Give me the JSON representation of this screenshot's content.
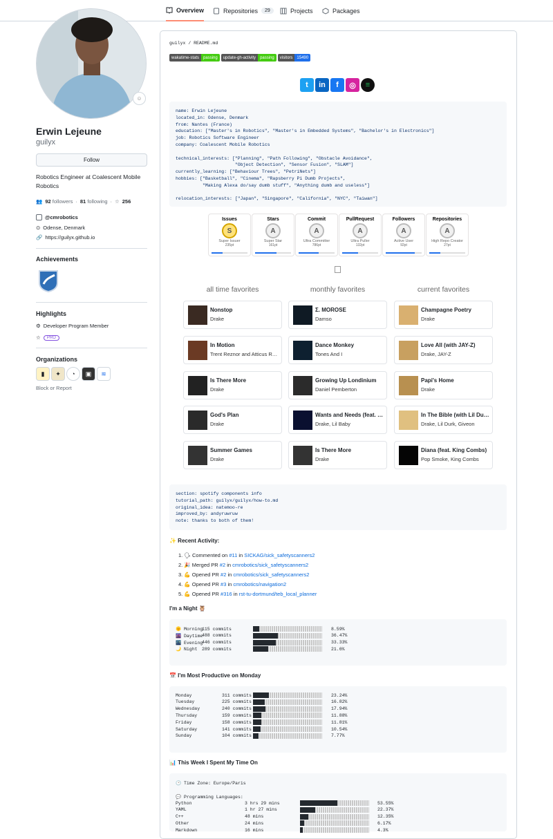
{
  "tabs": [
    {
      "label": "Overview",
      "icon": "book-icon"
    },
    {
      "label": "Repositories",
      "count": "29",
      "icon": "repo-icon"
    },
    {
      "label": "Projects",
      "icon": "project-icon"
    },
    {
      "label": "Packages",
      "icon": "package-icon"
    }
  ],
  "profile": {
    "name": "Erwin Lejeune",
    "login": "guilyx",
    "follow_label": "Follow",
    "bio": "Robotics Engineer at Coalescent Mobile Robotics",
    "followers": "92",
    "followers_label": "followers",
    "following": "81",
    "following_label": "following",
    "stars": "256",
    "org": "@cmrobotics",
    "location": "Odense, Denmark",
    "website": "https://guilyx.github.io"
  },
  "sidebar": {
    "achievements_title": "Achievements",
    "highlights_title": "Highlights",
    "highlight_member": "Developer Program Member",
    "pro_label": "PRO",
    "organizations_title": "Organizations",
    "block_label": "Block or Report"
  },
  "readme": {
    "crumb_user": "guilyx",
    "crumb_sep": "/",
    "crumb_file": "README.md",
    "shields": [
      {
        "label": "wakatime-stats",
        "value": "passing",
        "color": "#4c1"
      },
      {
        "label": "update-gh-activity",
        "value": "passing",
        "color": "#4c1"
      },
      {
        "label": "visitors",
        "value": "15490",
        "color": "#1f6feb"
      }
    ],
    "code1": "name: Erwin Lejeune\nlocated_in: Odense, Denmark\nfrom: Nantes (France)\neducation: [\"Master's in Robotics\", \"Master's in Embedded Systems\", \"Bachelor's in Electronics\"]\njob: Robotics Software Engineer\ncompany: Coalescent Mobile Robotics\n\ntechnical_interests: [\"Planning\", \"Path Following\", \"Obstacle Avoidance\",\n                      \"Object Detection\", \"Sensor Fusion\", \"SLAM\"]\ncurrently_learning: [\"Behaviour Trees\", \"PetriNets\"]\nhobbies: [\"Basketball\", \"Cinema\", \"Rapsberry Pi Dumb Projects\",\n          \"Making Alexa do/say dumb stuff\", \"Anything dumb and useless\"]\n\nrelocation_interests: [\"Japan\", \"Singapore\", \"California\", \"NYC\", \"Taiwan\"]",
    "trophies": [
      {
        "title": "Issues",
        "rank": "S",
        "rank_title": "Super Issuer",
        "points": "235pt",
        "progress": 0.3
      },
      {
        "title": "Stars",
        "rank": "A",
        "rank_title": "Super Star",
        "points": "161pt",
        "progress": 0.6
      },
      {
        "title": "Commit",
        "rank": "A",
        "rank_title": "Ultra Committer",
        "points": "786pt",
        "progress": 0.55
      },
      {
        "title": "PullRequest",
        "rank": "A",
        "rank_title": "Ultra Puller",
        "points": "132pt",
        "progress": 0.45
      },
      {
        "title": "Followers",
        "rank": "A",
        "rank_title": "Active User",
        "points": "92pt",
        "progress": 0.8
      },
      {
        "title": "Repositories",
        "rank": "A",
        "rank_title": "High Repo Creator",
        "points": "27pt",
        "progress": 0.3
      }
    ],
    "fav_headers": [
      "all time favorites",
      "monthly favorites",
      "current favorites"
    ],
    "favorites": [
      [
        {
          "t": "Nonstop",
          "a": "Drake"
        },
        {
          "t": "In Motion",
          "a": "Trent Reznor and Atticus Ross"
        },
        {
          "t": "Is There More",
          "a": "Drake"
        },
        {
          "t": "God's Plan",
          "a": "Drake"
        },
        {
          "t": "Summer Games",
          "a": "Drake"
        }
      ],
      [
        {
          "t": "Σ. MOROSE",
          "a": "Damso"
        },
        {
          "t": "Dance Monkey",
          "a": "Tones And I"
        },
        {
          "t": "Growing Up Londinium",
          "a": "Daniel Pemberton"
        },
        {
          "t": "Wants and Needs (feat. Lil Baby)",
          "a": "Drake, Lil Baby"
        },
        {
          "t": "Is There More",
          "a": "Drake"
        }
      ],
      [
        {
          "t": "Champagne Poetry",
          "a": "Drake"
        },
        {
          "t": "Love All (with JAY-Z)",
          "a": "Drake, JAY-Z"
        },
        {
          "t": "Papi's Home",
          "a": "Drake"
        },
        {
          "t": "In The Bible (with Lil Durk & Giveon)",
          "a": "Drake, Lil Durk, Giveon"
        },
        {
          "t": "Diana (feat. King Combs)",
          "a": "Pop Smoke, King Combs"
        }
      ]
    ],
    "code2": "section: spotify components info\ntutorial_path: guilyx/guilyx/how-to.md\noriginal_idea: natemoo-re\nimproved_by: andyruwruw\nnote: thanks to both of them!",
    "recent_title": "✨ Recent Activity:",
    "activity": [
      {
        "pre": "1. 🗣 Commented on ",
        "link1": "#11",
        "mid": " in ",
        "link2": "SICKAG/sick_safetyscanners2"
      },
      {
        "pre": "2. 🎉 Merged PR ",
        "link1": "#2",
        "mid": " in ",
        "link2": "cmrobotics/sick_safetyscanners2"
      },
      {
        "pre": "3. 💪 Opened PR ",
        "link1": "#2",
        "mid": " in ",
        "link2": "cmrobotics/sick_safetyscanners2"
      },
      {
        "pre": "4. 💪 Opened PR ",
        "link1": "#3",
        "mid": " in ",
        "link2": "cmrobotics/navigation2"
      },
      {
        "pre": "5. 💪 Opened PR ",
        "link1": "#316",
        "mid": " in ",
        "link2": "rst-tu-dortmund/teb_local_planner"
      }
    ],
    "night_title": "I'm a Night 🦉",
    "night": [
      {
        "l": "🌞 Morning",
        "c": "115 commits",
        "p": "8.59%",
        "v": 0.0859
      },
      {
        "l": "🌆 Daytime",
        "c": "488 commits",
        "p": "36.47%",
        "v": 0.3647
      },
      {
        "l": "🌃 Evening",
        "c": "446 commits",
        "p": "33.33%",
        "v": 0.3333
      },
      {
        "l": "🌙 Night",
        "c": "289 commits",
        "p": "21.6%",
        "v": 0.216
      }
    ],
    "monday_title": "📅 I'm Most Productive on Monday",
    "days": [
      {
        "l": "Monday",
        "c": "311 commits",
        "p": "23.24%",
        "v": 0.2324
      },
      {
        "l": "Tuesday",
        "c": "225 commits",
        "p": "16.82%",
        "v": 0.1682
      },
      {
        "l": "Wednesday",
        "c": "240 commits",
        "p": "17.94%",
        "v": 0.1794
      },
      {
        "l": "Thursday",
        "c": "159 commits",
        "p": "11.88%",
        "v": 0.1188
      },
      {
        "l": "Friday",
        "c": "158 commits",
        "p": "11.81%",
        "v": 0.1181
      },
      {
        "l": "Saturday",
        "c": "141 commits",
        "p": "10.54%",
        "v": 0.1054
      },
      {
        "l": "Sunday",
        "c": "104 commits",
        "p": "7.77%",
        "v": 0.0777
      }
    ],
    "week_title": "📊 This Week I Spent My Time On",
    "timezone": "🕑 Time Zone: Europe/Paris",
    "lang_title": "💬 Programming Languages:",
    "langs": [
      {
        "l": "Python",
        "c": "3 hrs 29 mins",
        "p": "53.55%",
        "v": 0.5355
      },
      {
        "l": "YAML",
        "c": "1 hr 27 mins",
        "p": "22.37%",
        "v": 0.2237
      },
      {
        "l": "C++",
        "c": "48 mins",
        "p": "12.35%",
        "v": 0.1235
      },
      {
        "l": "Other",
        "c": "24 mins",
        "p": "6.17%",
        "v": 0.0617
      },
      {
        "l": "Markdown",
        "c": "16 mins",
        "p": "4.3%",
        "v": 0.043
      }
    ]
  },
  "colors": {
    "accent": "#fd8c73",
    "link": "#0969da",
    "border": "#d0d7de"
  }
}
